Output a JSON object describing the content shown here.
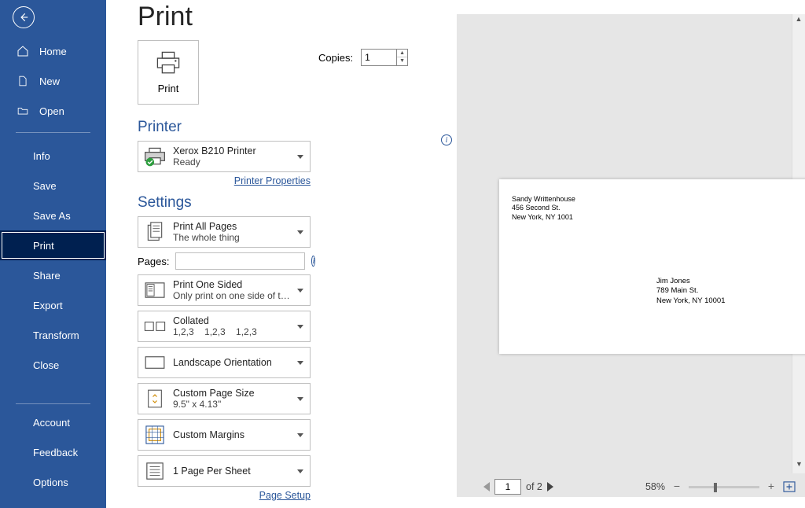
{
  "sidebar": {
    "items": [
      {
        "label": "Home"
      },
      {
        "label": "New"
      },
      {
        "label": "Open"
      },
      {
        "label": "Info"
      },
      {
        "label": "Save"
      },
      {
        "label": "Save As"
      },
      {
        "label": "Print"
      },
      {
        "label": "Share"
      },
      {
        "label": "Export"
      },
      {
        "label": "Transform"
      },
      {
        "label": "Close"
      }
    ],
    "bottom": [
      {
        "label": "Account"
      },
      {
        "label": "Feedback"
      },
      {
        "label": "Options"
      }
    ]
  },
  "page": {
    "title": "Print"
  },
  "printTile": {
    "label": "Print"
  },
  "copies": {
    "label": "Copies:",
    "value": "1"
  },
  "printerSection": {
    "heading": "Printer"
  },
  "printer": {
    "name": "Xerox B210 Printer",
    "status": "Ready"
  },
  "links": {
    "printerProps": "Printer Properties",
    "pageSetup": "Page Setup"
  },
  "settingsSection": {
    "heading": "Settings"
  },
  "pages": {
    "label": "Pages:"
  },
  "settings": {
    "scope": {
      "title": "Print All Pages",
      "sub": "The whole thing"
    },
    "sides": {
      "title": "Print One Sided",
      "sub": "Only print on one side of the..."
    },
    "collate": {
      "title": "Collated",
      "sub": "1,2,3    1,2,3    1,2,3"
    },
    "orient": {
      "title": "Landscape Orientation"
    },
    "size": {
      "title": "Custom Page Size",
      "sub": "9.5\" x 4.13\""
    },
    "margins": {
      "title": "Custom Margins"
    },
    "sheet": {
      "title": "1 Page Per Sheet"
    }
  },
  "preview": {
    "sender": {
      "l1": "Sandy Writtenhouse",
      "l2": "456 Second St.",
      "l3": "New York, NY 1001"
    },
    "recipient": {
      "l1": "Jim Jones",
      "l2": "789 Main St.",
      "l3": "New York, NY 10001"
    },
    "pager": {
      "current": "1",
      "of": "of 2"
    },
    "zoom": "58%"
  }
}
